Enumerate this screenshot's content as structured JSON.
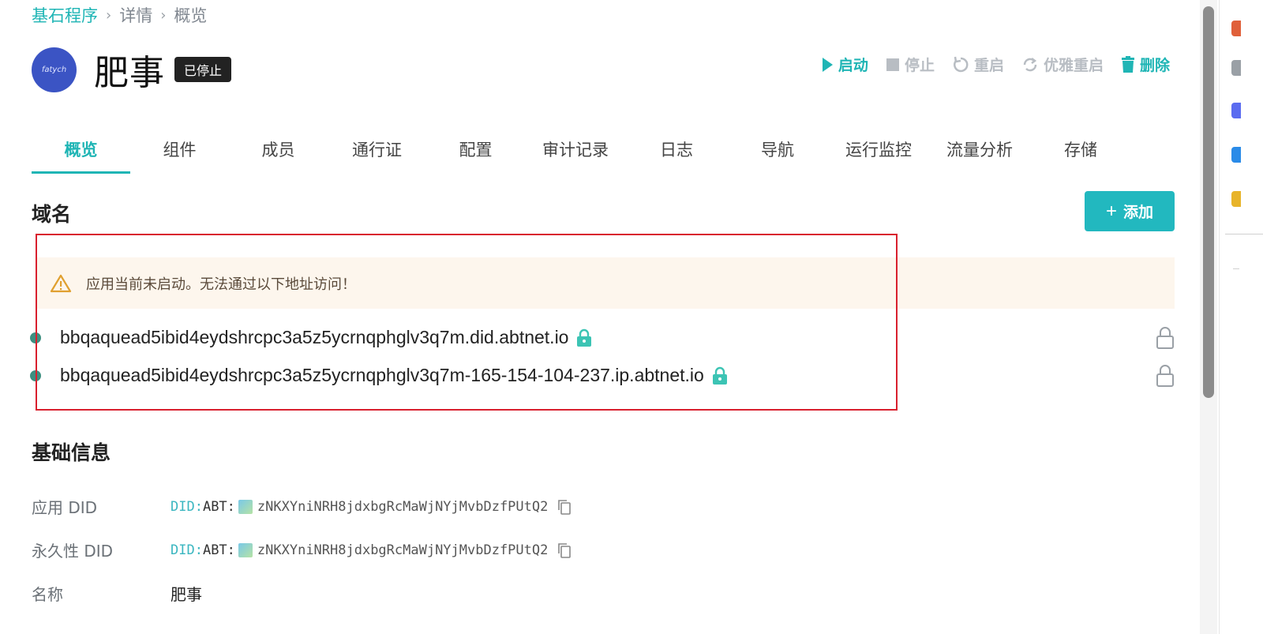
{
  "breadcrumb": {
    "root": "基石程序",
    "detail": "详情",
    "current": "概览"
  },
  "app": {
    "avatar_text": "fatych",
    "title": "肥事",
    "status": "已停止"
  },
  "actions": {
    "start": "启动",
    "stop": "停止",
    "restart": "重启",
    "graceful_restart": "优雅重启",
    "delete": "删除"
  },
  "tabs": [
    "概览",
    "组件",
    "成员",
    "通行证",
    "配置",
    "审计记录",
    "日志",
    "导航",
    "运行监控",
    "流量分析",
    "存储"
  ],
  "domains": {
    "title": "域名",
    "add_label": "添加",
    "warning": "应用当前未启动。无法通过以下地址访问！",
    "items": [
      "bbqaquead5ibid4eydshrcpc3a5z5ycrnqphglv3q7m.did.abtnet.io",
      "bbqaquead5ibid4eydshrcpc3a5z5ycrnqphglv3q7m-165-154-104-237.ip.abtnet.io"
    ]
  },
  "basic_info": {
    "title": "基础信息",
    "rows": {
      "app_did": {
        "label": "应用 DID",
        "prefix": "DID:",
        "method": "ABT:",
        "value": "zNKXYniNRH8jdxbgRcMaWjNYjMvbDzfPUtQ2"
      },
      "permanent_did": {
        "label": "永久性 DID",
        "prefix": "DID:",
        "method": "ABT:",
        "value": "zNKXYniNRH8jdxbgRcMaWjNYjMvbDzfPUtQ2"
      },
      "name": {
        "label": "名称",
        "value": "肥事"
      }
    }
  },
  "colors": {
    "accent": "#1fb5b5",
    "warning_bg": "#fdf6ed",
    "highlight": "#d9202e",
    "disabled": "#b8bdc3"
  }
}
